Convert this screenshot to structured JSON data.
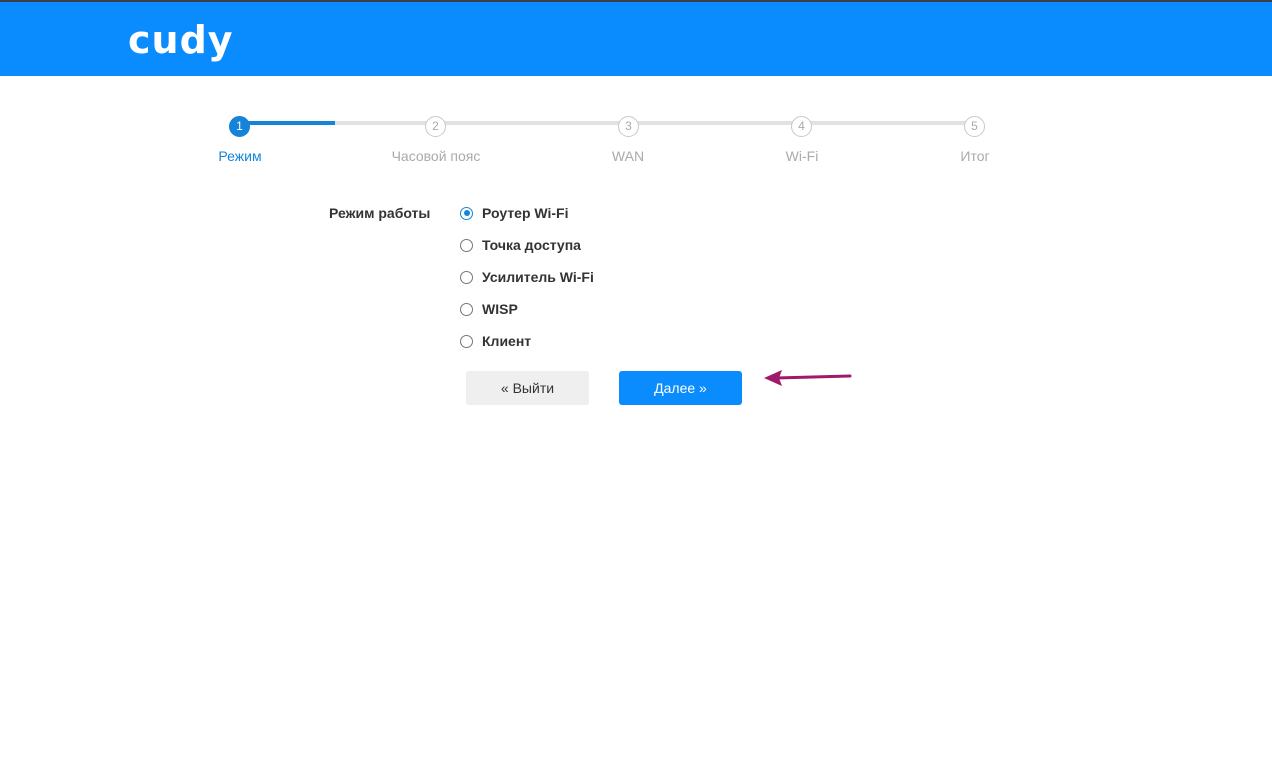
{
  "header": {
    "logo_text": "cudy",
    "brand_color": "#0a8cff"
  },
  "stepper": {
    "active_color": "#1584d8",
    "steps": [
      {
        "number": "1",
        "label": "Режим",
        "active": true
      },
      {
        "number": "2",
        "label": "Часовой пояс",
        "active": false
      },
      {
        "number": "3",
        "label": "WAN",
        "active": false
      },
      {
        "number": "4",
        "label": "Wi-Fi",
        "active": false
      },
      {
        "number": "5",
        "label": "Итог",
        "active": false
      }
    ]
  },
  "form": {
    "mode_label": "Режим работы",
    "options": [
      {
        "label": "Роутер Wi-Fi",
        "checked": true
      },
      {
        "label": "Точка доступа",
        "checked": false
      },
      {
        "label": "Усилитель Wi-Fi",
        "checked": false
      },
      {
        "label": "WISP",
        "checked": false
      },
      {
        "label": "Клиент",
        "checked": false
      }
    ]
  },
  "buttons": {
    "exit_label": "« Выйти",
    "next_label": "Далее »"
  },
  "annotation": {
    "arrow_color": "#a0196a"
  }
}
